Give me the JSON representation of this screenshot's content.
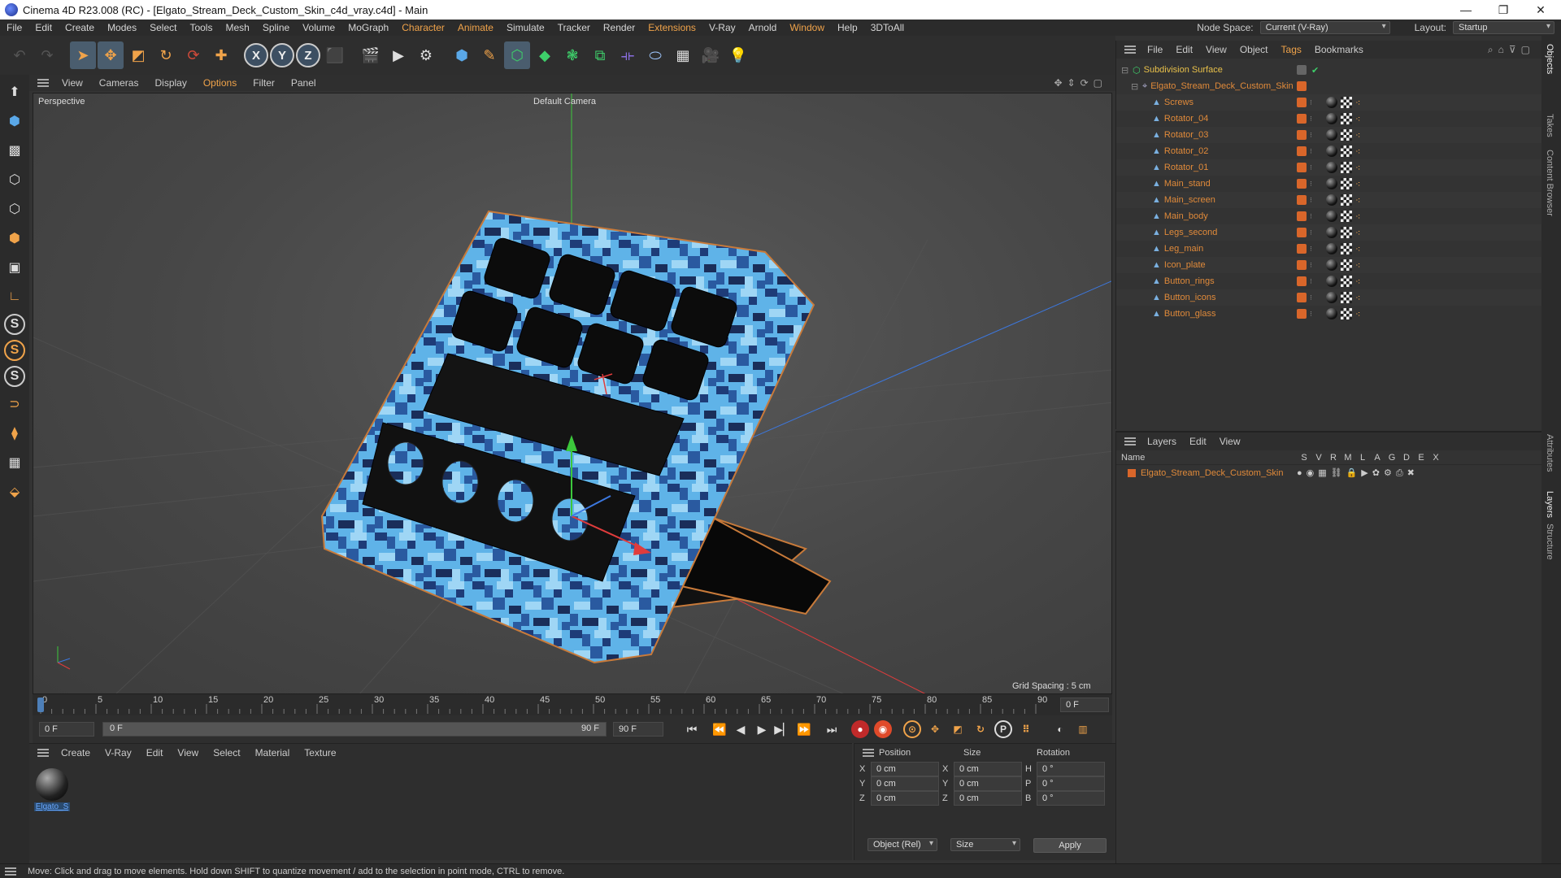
{
  "window": {
    "title": "Cinema 4D R23.008 (RC) - [Elgato_Stream_Deck_Custom_Skin_c4d_vray.c4d] - Main",
    "controls": [
      "—",
      "❐",
      "✕"
    ]
  },
  "menubar": {
    "items": [
      "File",
      "Edit",
      "Create",
      "Modes",
      "Select",
      "Tools",
      "Mesh",
      "Spline",
      "Volume",
      "MoGraph",
      "Character",
      "Animate",
      "Simulate",
      "Tracker",
      "Render",
      "Extensions",
      "V-Ray",
      "Arnold",
      "Window",
      "Help",
      "3DToAll"
    ],
    "node_space_label": "Node Space:",
    "node_space_value": "Current (V-Ray)",
    "layout_label": "Layout:",
    "layout_value": "Startup"
  },
  "viewport": {
    "menu": [
      "View",
      "Cameras",
      "Display",
      "Options",
      "Filter",
      "Panel"
    ],
    "view_name": "Perspective",
    "camera": "Default Camera",
    "grid_spacing": "Grid Spacing : 5 cm"
  },
  "timeline": {
    "ticks": [
      "0",
      "5",
      "10",
      "15",
      "20",
      "25",
      "30",
      "35",
      "40",
      "45",
      "50",
      "55",
      "60",
      "65",
      "70",
      "75",
      "80",
      "85",
      "90"
    ],
    "end_field": "0 F",
    "start_frame": "0 F",
    "current_frame": "0 F",
    "range_end": "90 F",
    "max_frame": "90 F"
  },
  "materials": {
    "menu": [
      "Create",
      "V-Ray",
      "Edit",
      "View",
      "Select",
      "Material",
      "Texture"
    ],
    "items": [
      {
        "name": "Elgato_S"
      }
    ]
  },
  "attributes": {
    "headers": [
      "Position",
      "Size",
      "Rotation"
    ],
    "rows": [
      {
        "axis": "X",
        "pos": "0 cm",
        "size_axis": "X",
        "size": "0 cm",
        "rot_axis": "H",
        "rot": "0 °"
      },
      {
        "axis": "Y",
        "pos": "0 cm",
        "size_axis": "Y",
        "size": "0 cm",
        "rot_axis": "P",
        "rot": "0 °"
      },
      {
        "axis": "Z",
        "pos": "0 cm",
        "size_axis": "Z",
        "size": "0 cm",
        "rot_axis": "B",
        "rot": "0 °"
      }
    ],
    "coord_mode": "Object (Rel)",
    "size_mode": "Size",
    "apply_label": "Apply"
  },
  "object_manager": {
    "menu": [
      "File",
      "Edit",
      "View",
      "Object",
      "Tags",
      "Bookmarks"
    ],
    "root": "Subdivision Surface",
    "group": "Elgato_Stream_Deck_Custom_Skin",
    "children": [
      "Screws",
      "Rotator_04",
      "Rotator_03",
      "Rotator_02",
      "Rotator_01",
      "Main_stand",
      "Main_screen",
      "Main_body",
      "Legs_second",
      "Leg_main",
      "Icon_plate",
      "Button_rings",
      "Button_icons",
      "Button_glass"
    ]
  },
  "layers": {
    "menu": [
      "Layers",
      "Edit",
      "View"
    ],
    "name_header": "Name",
    "flags": [
      "S",
      "V",
      "R",
      "M",
      "L",
      "A",
      "G",
      "D",
      "E",
      "X"
    ],
    "items": [
      {
        "name": "Elgato_Stream_Deck_Custom_Skin",
        "color": "#d9662a"
      }
    ]
  },
  "right_tabs": [
    "Objects",
    "Takes",
    "Content Browser",
    "Attributes",
    "Layers",
    "Structure"
  ],
  "status": {
    "message": "Move: Click and drag to move elements. Hold down SHIFT to quantize movement / add to the selection in point mode, CTRL to remove."
  },
  "colors": {
    "accent": "#f0a34a",
    "object_orange": "#d9662a",
    "axis_x": "#e03c3c",
    "axis_y": "#3cc83c",
    "axis_z": "#3c78e0"
  }
}
